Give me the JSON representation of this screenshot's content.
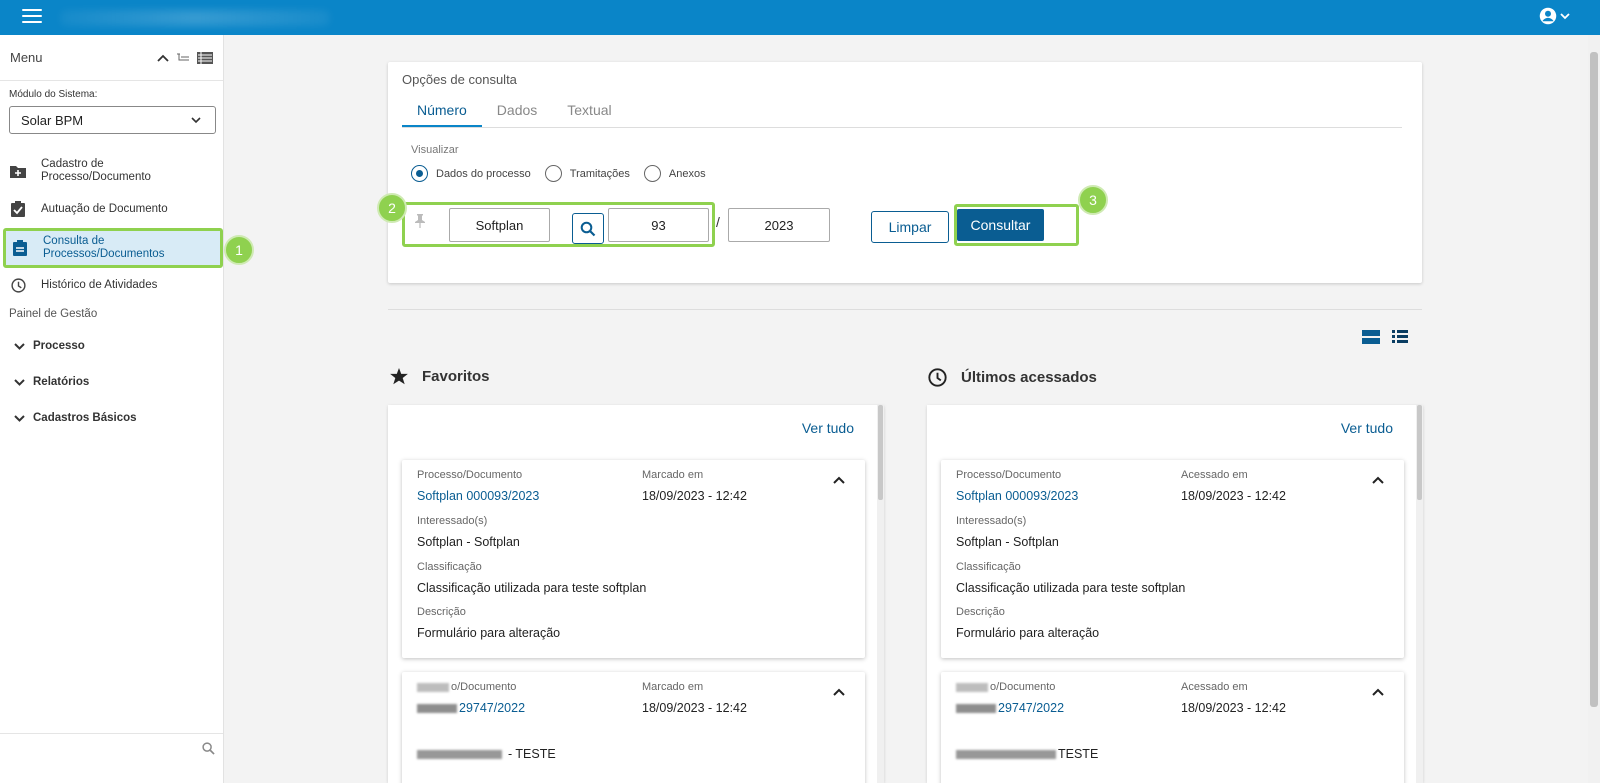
{
  "sidebar": {
    "menu_title": "Menu",
    "module_label": "Módulo do Sistema:",
    "module_value": "Solar BPM",
    "items": [
      {
        "label": "Cadastro de Processo/Documento",
        "icon": "folder-plus-icon"
      },
      {
        "label": "Autuação de Documento",
        "icon": "clipboard-check-icon"
      },
      {
        "label": "Consulta de Processos/Documentos",
        "icon": "clipboard-list-icon"
      },
      {
        "label": "Histórico de Atividades",
        "icon": "clock-icon"
      }
    ],
    "section_label": "Painel de Gestão",
    "groups": [
      "Processo",
      "Relatórios",
      "Cadastros Básicos"
    ],
    "badge": "1"
  },
  "consulta": {
    "title": "Opções de consulta",
    "tabs": [
      "Número",
      "Dados",
      "Textual"
    ],
    "active_tab": "Número",
    "visualizar_label": "Visualizar",
    "radios": [
      "Dados do processo",
      "Tramitações",
      "Anexos"
    ],
    "selected_radio": "Dados do processo",
    "org_value": "Softplan",
    "number_value": "93",
    "slash": "/",
    "year_value": "2023",
    "limpar_label": "Limpar",
    "consultar_label": "Consultar",
    "badge_2": "2",
    "badge_3": "3"
  },
  "favoritos": {
    "title": "Favoritos",
    "ver_tudo": "Ver tudo",
    "card1": {
      "proc_label": "Processo/Documento",
      "proc_value": "Softplan 000093/2023",
      "date_label": "Marcado em",
      "date_value": "18/09/2023 - 12:42",
      "int_label": "Interessado(s)",
      "int_value": "Softplan - Softplan",
      "class_label": "Classificação",
      "class_value": "Classificação utilizada para teste softplan",
      "desc_label": "Descrição",
      "desc_value": "Formulário para alteração"
    },
    "card2": {
      "proc_label_tail": "o/Documento",
      "proc_value_tail": "29747/2022",
      "date_label": "Marcado em",
      "date_value": "18/09/2023 - 12:42",
      "int_tail": "- TESTE"
    }
  },
  "ultimos": {
    "title": "Últimos acessados",
    "ver_tudo": "Ver tudo",
    "card1": {
      "proc_label": "Processo/Documento",
      "proc_value": "Softplan 000093/2023",
      "date_label": "Acessado em",
      "date_value": "18/09/2023 - 12:42",
      "int_label": "Interessado(s)",
      "int_value": "Softplan - Softplan",
      "class_label": "Classificação",
      "class_value": "Classificação utilizada para teste softplan",
      "desc_label": "Descrição",
      "desc_value": "Formulário para alteração"
    },
    "card2": {
      "proc_label_tail": "o/Documento",
      "proc_value_tail": "29747/2022",
      "date_label": "Acessado em",
      "date_value": "18/09/2023 - 12:42",
      "int_tail": "TESTE"
    }
  },
  "colors": {
    "topbar": "#0a85c8",
    "primary": "#0a5d92",
    "highlight": "#8fd14f"
  }
}
